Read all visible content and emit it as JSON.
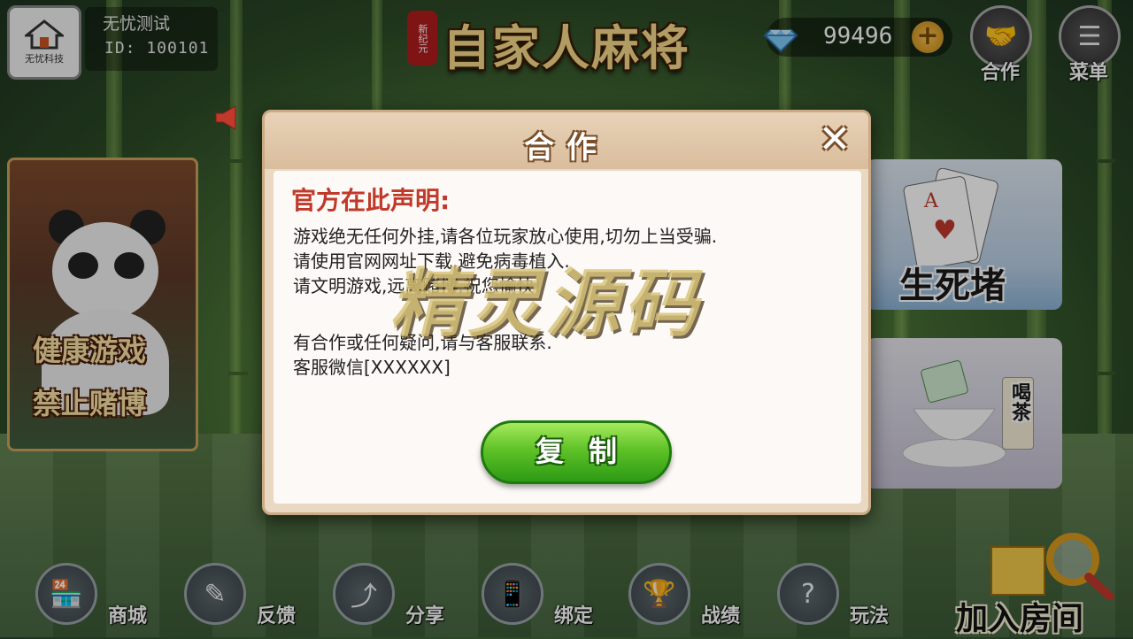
{
  "user": {
    "name": "无忧测试",
    "id_text": "ID: 100101",
    "avatar_brand": "无忧科技"
  },
  "logo": {
    "tag": "新纪元",
    "title": "自家人麻将"
  },
  "currency": {
    "diamonds": "99496"
  },
  "top_buttons": [
    {
      "label": "合作",
      "icon": "handshake-icon"
    },
    {
      "label": "菜单",
      "icon": "menu-icon"
    }
  ],
  "left_card": {
    "line1": "健康游戏",
    "line2": "禁止赌博"
  },
  "right_cards": [
    {
      "label": "生死堵"
    },
    {
      "label": "喝茶"
    }
  ],
  "dialog": {
    "title": "合作",
    "heading": "官方在此声明:",
    "lines": [
      "游戏绝无任何外挂,请各位玩家放心使用,切勿上当受骗.",
      "请使用官网网址下载,避免病毒植入.",
      "请文明游戏,远离赌博,祝您愉快!",
      "有合作或任何疑问,请与客服联系.",
      "客服微信[XXXXXX]"
    ],
    "copy_button": "复制"
  },
  "watermark": "精灵源码",
  "bottom_nav": [
    {
      "label": "商城",
      "icon": "shop-icon"
    },
    {
      "label": "反馈",
      "icon": "feedback-icon"
    },
    {
      "label": "分享",
      "icon": "share-icon"
    },
    {
      "label": "绑定",
      "icon": "bind-icon"
    },
    {
      "label": "战绩",
      "icon": "trophy-icon"
    },
    {
      "label": "玩法",
      "icon": "help-icon"
    }
  ],
  "join_room": "加入房间",
  "colors": {
    "heading_red": "#c0392b",
    "button_green": "#5fc227",
    "gold": "#f6d98a"
  }
}
